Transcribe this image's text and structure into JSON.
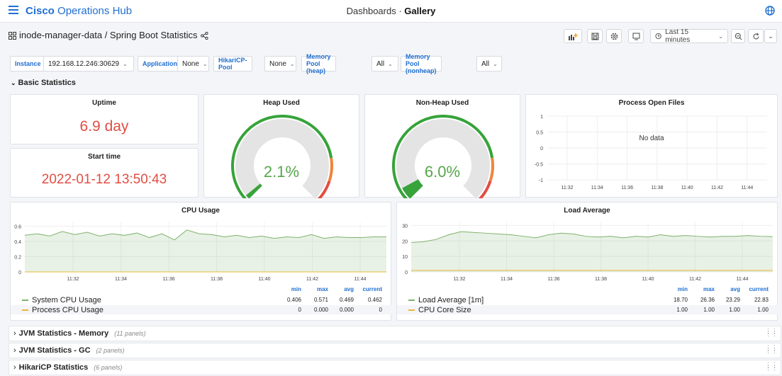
{
  "app": {
    "name_bold": "Cisco",
    "name_rest": " Operations Hub"
  },
  "breadcrumb": {
    "parent": "Dashboards",
    "separator": " · ",
    "current": "Gallery"
  },
  "dashboard": {
    "title": "inode-manager-data / Spring Boot Statistics"
  },
  "toolbar": {
    "time_range": "Last 15 minutes"
  },
  "variables": [
    {
      "label": "Instance",
      "value": "192.168.12.246:30629"
    },
    {
      "label": "Application",
      "value": "None"
    },
    {
      "label": "HikariCP-Pool",
      "value": "None"
    },
    {
      "label": "Memory Pool (heap)",
      "value": "All"
    },
    {
      "label": "Memory Pool (nonheap)",
      "value": "All"
    }
  ],
  "section": {
    "title": "Basic Statistics"
  },
  "uptime": {
    "title": "Uptime",
    "value": "6.9 day"
  },
  "start_time": {
    "title": "Start time",
    "value": "2022-01-12 13:50:43"
  },
  "heap": {
    "title": "Heap Used",
    "value": "2.1%",
    "fraction": 0.021
  },
  "nonheap": {
    "title": "Non-Heap Used",
    "value": "6.0%",
    "fraction": 0.06
  },
  "open_files": {
    "title": "Process Open Files",
    "no_data": "No data",
    "y_ticks": [
      "1",
      "0.5",
      "0",
      "-0.5",
      "-1"
    ],
    "x_ticks": [
      "11:32",
      "11:34",
      "11:36",
      "11:38",
      "11:40",
      "11:42",
      "11:44"
    ]
  },
  "cpu": {
    "title": "CPU Usage",
    "legend_headers": [
      "min",
      "max",
      "avg",
      "current"
    ],
    "series": [
      {
        "name": "System CPU Usage",
        "color": "#7eb26d",
        "stats": [
          "0.406",
          "0.571",
          "0.469",
          "0.462"
        ]
      },
      {
        "name": "Process CPU Usage",
        "color": "#eab839",
        "stats": [
          "0",
          "0.000",
          "0.000",
          "0"
        ]
      }
    ]
  },
  "load": {
    "title": "Load Average",
    "legend_headers": [
      "min",
      "max",
      "avg",
      "current"
    ],
    "series": [
      {
        "name": "Load Average [1m]",
        "color": "#7eb26d",
        "stats": [
          "18.70",
          "26.36",
          "23.29",
          "22.83"
        ]
      },
      {
        "name": "CPU Core Size",
        "color": "#eab839",
        "stats": [
          "1.00",
          "1.00",
          "1.00",
          "1.00"
        ]
      }
    ]
  },
  "chart_data": [
    {
      "type": "line",
      "title": "CPU Usage",
      "x": [
        "11:31",
        "11:31:30",
        "11:32",
        "11:32:30",
        "11:33",
        "11:33:30",
        "11:34",
        "11:34:30",
        "11:35",
        "11:35:30",
        "11:36",
        "11:36:30",
        "11:37",
        "11:37:30",
        "11:38",
        "11:38:30",
        "11:39",
        "11:39:30",
        "11:40",
        "11:40:30",
        "11:41",
        "11:41:30",
        "11:42",
        "11:42:30",
        "11:43",
        "11:43:30",
        "11:44",
        "11:44:30",
        "11:45",
        "11:45:30"
      ],
      "x_tick_labels": [
        "11:32",
        "11:34",
        "11:36",
        "11:38",
        "11:40",
        "11:42",
        "11:44"
      ],
      "y_tick_labels": [
        "0",
        "0.2",
        "0.4",
        "0.6"
      ],
      "ylim": [
        0,
        0.65
      ],
      "series": [
        {
          "name": "System CPU Usage",
          "values": [
            0.48,
            0.5,
            0.47,
            0.53,
            0.49,
            0.52,
            0.47,
            0.5,
            0.48,
            0.51,
            0.45,
            0.5,
            0.42,
            0.55,
            0.5,
            0.49,
            0.46,
            0.48,
            0.45,
            0.47,
            0.44,
            0.46,
            0.45,
            0.49,
            0.44,
            0.46,
            0.45,
            0.45,
            0.46,
            0.46
          ]
        },
        {
          "name": "Process CPU Usage",
          "values": [
            0,
            0,
            0,
            0,
            0,
            0,
            0,
            0,
            0,
            0,
            0,
            0,
            0,
            0,
            0,
            0,
            0,
            0,
            0,
            0,
            0,
            0,
            0,
            0,
            0,
            0,
            0,
            0,
            0,
            0
          ]
        }
      ]
    },
    {
      "type": "line",
      "title": "Load Average",
      "x": [
        "11:31",
        "11:31:30",
        "11:32",
        "11:32:30",
        "11:33",
        "11:33:30",
        "11:34",
        "11:34:30",
        "11:35",
        "11:35:30",
        "11:36",
        "11:36:30",
        "11:37",
        "11:37:30",
        "11:38",
        "11:38:30",
        "11:39",
        "11:39:30",
        "11:40",
        "11:40:30",
        "11:41",
        "11:41:30",
        "11:42",
        "11:42:30",
        "11:43",
        "11:43:30",
        "11:44",
        "11:44:30",
        "11:45",
        "11:45:30"
      ],
      "x_tick_labels": [
        "11:32",
        "11:34",
        "11:36",
        "11:38",
        "11:40",
        "11:42",
        "11:44"
      ],
      "y_tick_labels": [
        "0",
        "10",
        "20",
        "30"
      ],
      "ylim": [
        0,
        32
      ],
      "series": [
        {
          "name": "Load Average [1m]",
          "values": [
            19,
            19.5,
            21,
            24,
            26,
            25.5,
            25,
            24.5,
            24,
            23,
            22,
            24,
            25,
            24.5,
            23,
            22.5,
            23,
            22,
            23,
            22.5,
            24,
            23,
            23.5,
            23,
            22.5,
            23,
            23,
            23.5,
            23,
            22.8
          ]
        },
        {
          "name": "CPU Core Size",
          "values": [
            1,
            1,
            1,
            1,
            1,
            1,
            1,
            1,
            1,
            1,
            1,
            1,
            1,
            1,
            1,
            1,
            1,
            1,
            1,
            1,
            1,
            1,
            1,
            1,
            1,
            1,
            1,
            1,
            1,
            1
          ]
        }
      ]
    }
  ],
  "collapsed_rows": [
    {
      "title": "JVM Statistics - Memory",
      "count": "(11 panels)"
    },
    {
      "title": "JVM Statistics - GC",
      "count": "(2 panels)"
    },
    {
      "title": "HikariCP Statistics",
      "count": "(6 panels)"
    }
  ]
}
